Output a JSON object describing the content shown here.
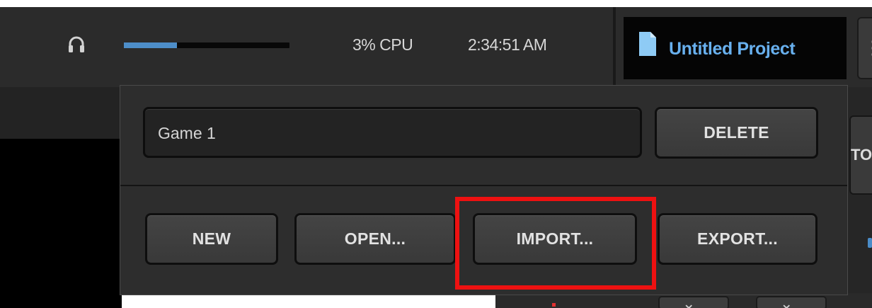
{
  "status_bar": {
    "audio_icon": "headphones-icon",
    "audio_level_percent": 32,
    "cpu": "3% CPU",
    "clock": "2:34:51 AM",
    "accent_color": "#4d8ec9"
  },
  "project": {
    "icon": "document-icon",
    "title": "Untitled Project",
    "title_color": "#68b0ee"
  },
  "behind": {
    "tab_fragment": "TO"
  },
  "project_menu": {
    "name_value": "Game 1",
    "delete_label": "DELETE",
    "new_label": "NEW",
    "open_label": "OPEN...",
    "import_label": "IMPORT...",
    "export_label": "EXPORT...",
    "highlighted": "IMPORT...",
    "highlight_color": "#ee1111"
  }
}
